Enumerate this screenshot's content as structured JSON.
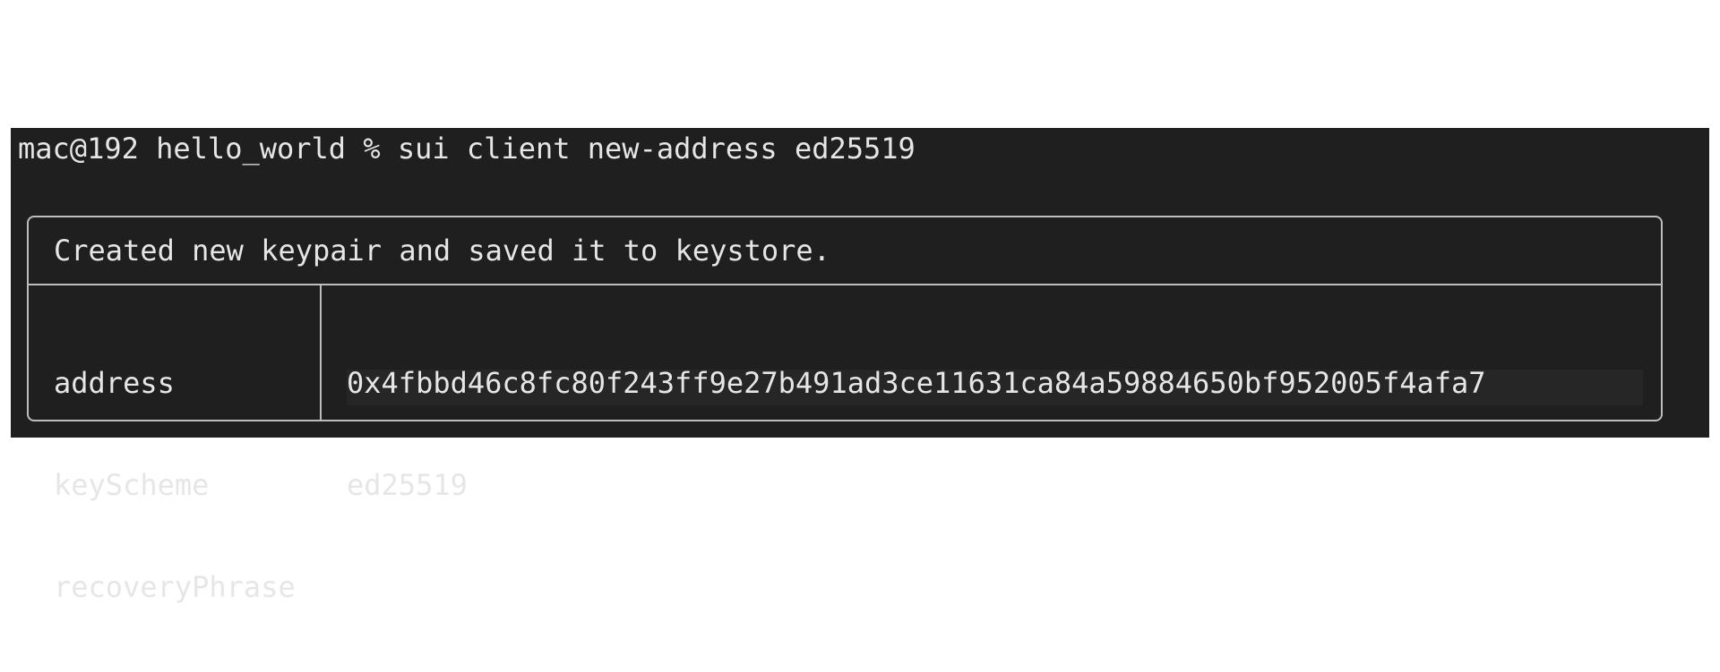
{
  "terminal": {
    "prompt": "mac@192 hello_world % sui client new-address ed25519",
    "output": {
      "header": "Created new keypair and saved it to keystore.",
      "rows": [
        {
          "key": "address",
          "value": "0x4fbbd46c8fc80f243ff9e27b491ad3ce11631ca84a59884650bf952005f4afa7"
        },
        {
          "key": "keyScheme",
          "value": "ed25519"
        },
        {
          "key": "recoveryPhrase",
          "value": ""
        }
      ]
    }
  },
  "colors": {
    "terminal_background": "#1f1f1f",
    "text": "#e6e6e6",
    "border": "#bdbdbd"
  }
}
